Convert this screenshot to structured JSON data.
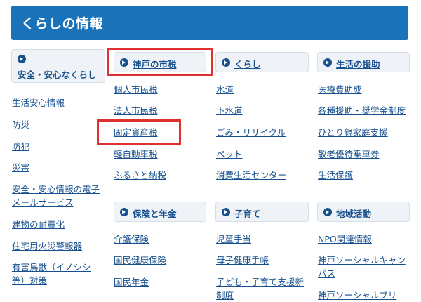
{
  "header": {
    "title": "くらしの情報"
  },
  "sections": {
    "safety": {
      "title": "安全・安心なくらし",
      "links": [
        "生活安心情報",
        "防災",
        "防犯",
        "災害",
        "安全・安心情報の電子",
        "メールサービス",
        "建物の耐震化",
        "住宅用火災警報器",
        "有害鳥獣（イノシシ",
        "等）対策"
      ]
    },
    "tax": {
      "title": "神戸の市税",
      "links": [
        "個人市民税",
        "法人市民税",
        "固定資産税",
        "軽自動車税",
        "ふるさと納税"
      ]
    },
    "living": {
      "title": "くらし",
      "links": [
        "水道",
        "下水道",
        "ごみ・リサイクル",
        "ペット",
        "消費生活センター"
      ]
    },
    "support": {
      "title": "生活の援助",
      "links": [
        "医療費助成",
        "各種援助・奨学金制度",
        "ひとり親家庭支援",
        "敬老優待乗車券",
        "生活保護"
      ]
    },
    "insurance": {
      "title": "保険と年金",
      "links": [
        "介護保険",
        "国民健康保険",
        "国民年金"
      ]
    },
    "childcare": {
      "title": "子育て",
      "links": [
        "児童手当",
        "母子健康手帳",
        "子ども・子育て支援新",
        "制度"
      ]
    },
    "community": {
      "title": "地域活動",
      "links": [
        "NPO関連情報",
        "神戸ソーシャルキャン",
        "パス",
        "神戸ソーシャルブリ"
      ]
    }
  },
  "colors": {
    "header_bg": "#1a72b8",
    "link": "#16508e",
    "highlight": "#e03030"
  }
}
